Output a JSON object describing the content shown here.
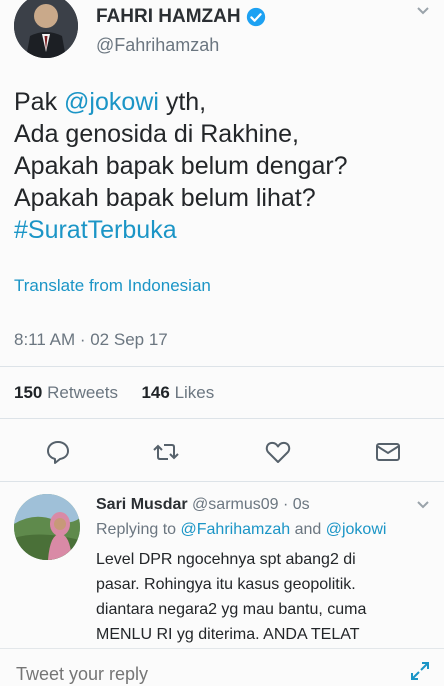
{
  "tweet": {
    "display_name": "FAHRI HAMZAH",
    "handle": "@Fahrihamzah",
    "text_line1_prefix": "Pak ",
    "mention_jokowi": "@jokowi",
    "text_line1_suffix": " yth,",
    "text_line2": "Ada genosida di Rakhine,",
    "text_line3": "Apakah bapak belum dengar?",
    "text_line4": "Apakah bapak belum lihat?",
    "hashtag": "#SuratTerbuka",
    "translate_label": "Translate from Indonesian",
    "timestamp": "8:11 AM · 02 Sep 17",
    "retweets_count": "150",
    "retweets_label": "Retweets",
    "likes_count": "146",
    "likes_label": "Likes"
  },
  "actions": [
    "reply-icon",
    "retweet-icon",
    "like-icon",
    "message-icon"
  ],
  "reply": {
    "name": "Sari Musdar",
    "handle_time": "@sarmus09 · 0s",
    "replying_prefix": "Replying to ",
    "replying_user1": "@Fahrihamzah",
    "replying_and": " and ",
    "replying_user2": "@jokowi",
    "line1": "Level DPR ngocehnya spt abang2 di",
    "line2": "pasar. Rohingya itu kasus geopolitik.",
    "line3": "diantara negara2 yg mau bantu, cuma",
    "line4": "MENLU RI yg diterima. ANDA TELAT"
  },
  "compose": {
    "placeholder": "Tweet your reply"
  },
  "colors": {
    "link": "#1b95c6",
    "muted": "#6b7680",
    "verified": "#1da1f2"
  }
}
